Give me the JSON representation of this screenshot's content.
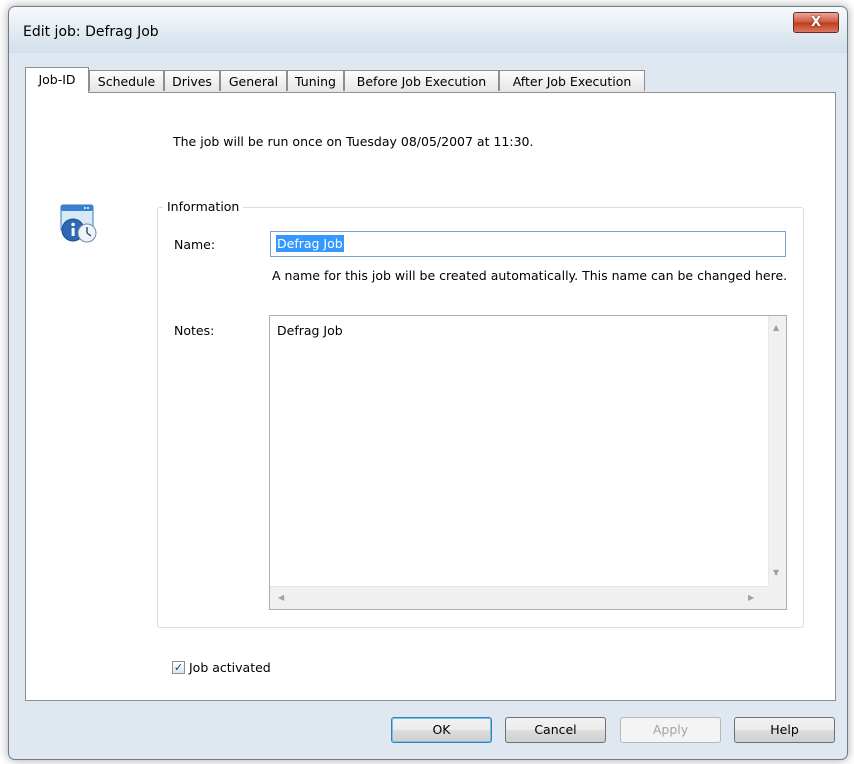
{
  "window": {
    "title": "Edit job: Defrag Job",
    "close_symbol": "X"
  },
  "tabs": [
    {
      "label": "Job-ID"
    },
    {
      "label": "Schedule"
    },
    {
      "label": "Drives"
    },
    {
      "label": "General"
    },
    {
      "label": "Tuning"
    },
    {
      "label": "Before Job Execution"
    },
    {
      "label": "After Job Execution"
    }
  ],
  "job_id": {
    "run_message": "The job will be run once on Tuesday 08/05/2007 at 11:30.",
    "group_title": "Information",
    "name_label": "Name:",
    "name_value": "Defrag Job",
    "name_hint": "A name for this job will be created automatically. This name can be changed here.",
    "notes_label": "Notes:",
    "notes_value": "Defrag Job",
    "activated_label": "Job activated",
    "activated_checked": true,
    "check_mark": "✓"
  },
  "icons": {
    "info": "info-window-icon",
    "scroll_up": "▲",
    "scroll_down": "▼",
    "scroll_left": "◀",
    "scroll_right": "▶"
  },
  "buttons": {
    "ok": "OK",
    "cancel": "Cancel",
    "apply": "Apply",
    "help": "Help"
  },
  "colors": {
    "selection": "#3399ff",
    "close_button": "#c13a1c",
    "window_frame": "#dfe8f1"
  }
}
